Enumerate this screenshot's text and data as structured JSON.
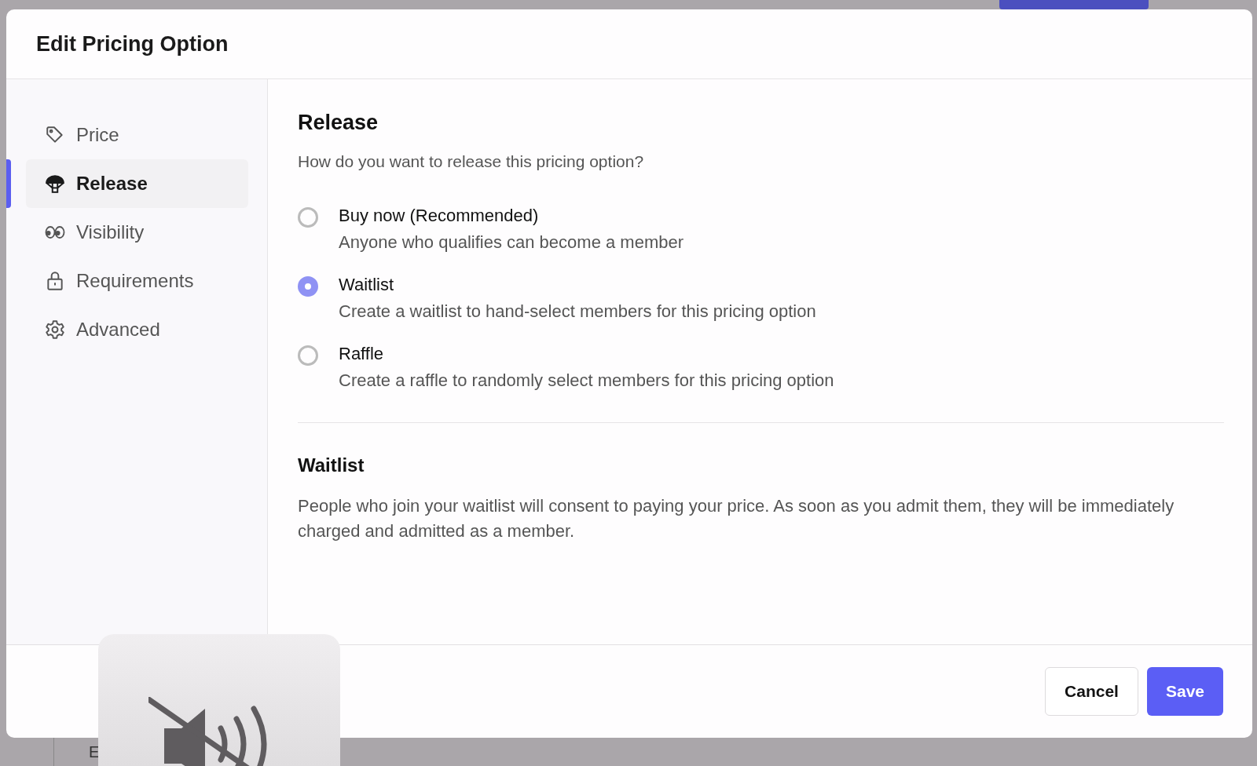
{
  "backdrop": {
    "bottom_text": "E"
  },
  "dialog": {
    "title": "Edit Pricing Option",
    "nav": [
      {
        "label": "Price",
        "selected": false
      },
      {
        "label": "Release",
        "selected": true
      },
      {
        "label": "Visibility",
        "selected": false
      },
      {
        "label": "Requirements",
        "selected": false
      },
      {
        "label": "Advanced",
        "selected": false
      }
    ],
    "section": {
      "title": "Release",
      "question": "How do you want to release this pricing option?",
      "options": [
        {
          "label": "Buy now (Recommended)",
          "description": "Anyone who qualifies can become a member",
          "selected": false
        },
        {
          "label": "Waitlist",
          "description": "Create a waitlist to hand-select members for this pricing option",
          "selected": true
        },
        {
          "label": "Raffle",
          "description": "Create a raffle to randomly select members for this pricing option",
          "selected": false
        }
      ]
    },
    "detail": {
      "title": "Waitlist",
      "text": "People who join your waitlist will consent to paying your price. As soon as you admit them, they will be immediately charged and admitted as a member."
    },
    "buttons": [
      {
        "label": "Cancel",
        "kind": "secondary"
      },
      {
        "label": "Save",
        "kind": "primary"
      }
    ]
  },
  "volume_hud": {
    "muted": true
  }
}
